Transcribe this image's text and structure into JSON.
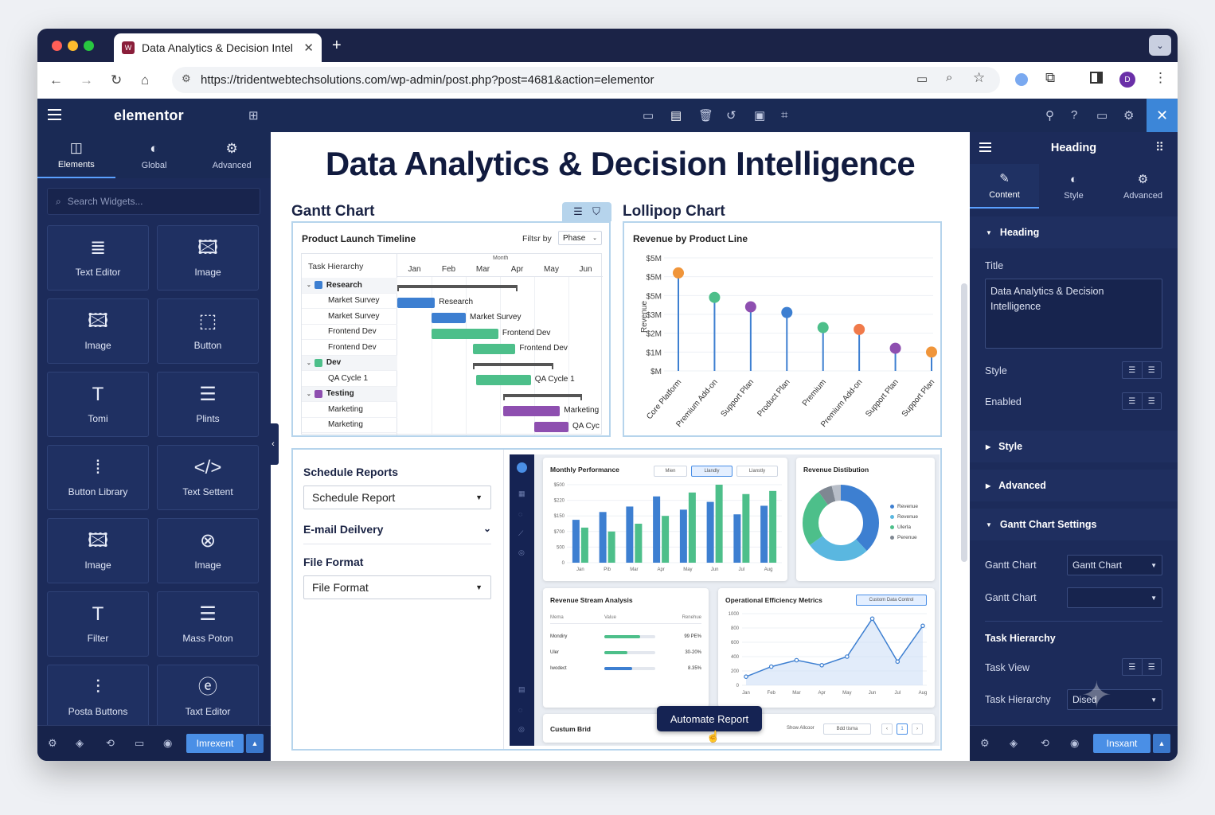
{
  "browser": {
    "tab_title": "Data Analytics & Decision Intel",
    "url": "https://tridentwebtechsolutions.com/wp-admin/post.php?post=4681&action=elementor",
    "profile_initial": "D"
  },
  "app": {
    "brand": "elementor"
  },
  "left_panel": {
    "tabs": [
      "Elements",
      "Global",
      "Advanced"
    ],
    "search_placeholder": "Search Widgets...",
    "widgets": [
      {
        "label": "Text Editor",
        "icon": "≣"
      },
      {
        "label": "Image",
        "icon": "🖾"
      },
      {
        "label": "Image",
        "icon": "🖾"
      },
      {
        "label": "Button",
        "icon": "⬚"
      },
      {
        "label": "Tomi",
        "icon": "T"
      },
      {
        "label": "Plints",
        "icon": "☰"
      },
      {
        "label": "Button Library",
        "icon": "⁞"
      },
      {
        "label": "Text Settent",
        "icon": "</>"
      },
      {
        "label": "Image",
        "icon": "🖾"
      },
      {
        "label": "Image",
        "icon": "⊗"
      },
      {
        "label": "Filter",
        "icon": "T"
      },
      {
        "label": "Mass Poton",
        "icon": "☰"
      },
      {
        "label": "Posta Buttons",
        "icon": "⫶"
      },
      {
        "label": "Taxt Editor",
        "icon": "ⓔ"
      }
    ],
    "footer_button": "Imrexent"
  },
  "page": {
    "title": "Data Analytics & Decision Intelligence",
    "gantt": {
      "section_title": "Gantt Chart",
      "card_title": "Product Launch Timeline",
      "filter_label": "Filtsr by",
      "filter_value": "Phase",
      "month_label": "Month",
      "hierarchy_header": "Task Hierarchy",
      "months": [
        "Jan",
        "Feb",
        "Mar",
        "Apr",
        "May",
        "Jun"
      ],
      "rows": [
        {
          "label": "Research",
          "group": true,
          "color": "#3d7fd1"
        },
        {
          "label": "Market Survey",
          "group": false
        },
        {
          "label": "Market Survey",
          "group": false
        },
        {
          "label": "Frontend Dev",
          "group": false
        },
        {
          "label": "Frontend Dev",
          "group": false
        },
        {
          "label": "Dev",
          "group": true,
          "color": "#4dbf8a"
        },
        {
          "label": "QA Cycle 1",
          "group": false
        },
        {
          "label": "Testing",
          "group": true,
          "color": "#8e4fb0"
        },
        {
          "label": "Marketing",
          "group": false
        },
        {
          "label": "Marketing",
          "group": false
        }
      ],
      "bars": [
        {
          "row": 0,
          "start": 0,
          "end": 3.5,
          "kind": "summary",
          "label": ""
        },
        {
          "row": 1,
          "start": 0,
          "end": 1.1,
          "kind": "blue",
          "label": "Research"
        },
        {
          "row": 2,
          "start": 1,
          "end": 2,
          "kind": "blue",
          "label": "Market Survey"
        },
        {
          "row": 3,
          "start": 1,
          "end": 2.95,
          "kind": "green",
          "label": "Frontend Dev"
        },
        {
          "row": 4,
          "start": 2.2,
          "end": 3.45,
          "kind": "green",
          "label": "Frontend Dev"
        },
        {
          "row": 5,
          "start": 2.2,
          "end": 4.55,
          "kind": "summary",
          "label": ""
        },
        {
          "row": 6,
          "start": 2.3,
          "end": 3.9,
          "kind": "green",
          "label": "QA Cycle 1"
        },
        {
          "row": 7,
          "start": 3.1,
          "end": 5.4,
          "kind": "summary",
          "label": ""
        },
        {
          "row": 8,
          "start": 3.1,
          "end": 4.75,
          "kind": "purple",
          "label": "Marketing"
        },
        {
          "row": 9,
          "start": 4,
          "end": 5,
          "kind": "purple",
          "label": "QA Cyc"
        }
      ]
    },
    "lollipop": {
      "section_title": "Lollipop Chart",
      "card_title": "Revenue by Product Line",
      "ylabel": "Revenue",
      "yticks": [
        "$5M",
        "$5M",
        "$5M",
        "$3M",
        "$2M",
        "$1M",
        "$M"
      ],
      "categories": [
        "Core Platform",
        "Premium Add-on",
        "Support Plan",
        "Product Plan",
        "Premium",
        "Premium Add-on",
        "Support Plan",
        "Support Plan"
      ],
      "values": [
        5.2,
        3.9,
        3.4,
        3.1,
        2.3,
        2.2,
        1.2,
        1.0
      ],
      "colors": [
        "#f0953a",
        "#4dbf8a",
        "#8e4fb0",
        "#3d7fd1",
        "#4dbf8a",
        "#f07a4a",
        "#8e4fb0",
        "#f0953a"
      ]
    },
    "schedule": {
      "title": "Schedule Reports",
      "select_value": "Schedule Report",
      "email_label": "E-mail Deilvery",
      "format_label": "File Format",
      "format_value": "File Format"
    },
    "dashboard": {
      "monthly": {
        "title": "Monthly Performance",
        "chips": [
          "Mien",
          "Llandly",
          "Llanstly"
        ],
        "yticks": [
          "$500",
          "$220",
          "$150",
          "$700",
          "500",
          "0"
        ],
        "months": [
          "Jan",
          "Pib",
          "Mar",
          "Apr",
          "May",
          "Jun",
          "Jul",
          "Aug"
        ],
        "series": [
          {
            "color": "#3d7fd1",
            "values": [
              0.55,
              0.65,
              0.72,
              0.85,
              0.68,
              0.78,
              0.62,
              0.73
            ]
          },
          {
            "color": "#4dbf8a",
            "values": [
              0.45,
              0.4,
              0.5,
              0.6,
              0.9,
              1.0,
              0.88,
              0.92
            ]
          }
        ]
      },
      "distribution": {
        "title": "Revenue Distibution",
        "legend": [
          "Revenue",
          "Revenue",
          "Ulerla",
          "Perenue"
        ],
        "slices": [
          {
            "value": 38,
            "color": "#3d7fd1"
          },
          {
            "value": 27,
            "color": "#5ab7e0"
          },
          {
            "value": 25,
            "color": "#4dbf8a"
          },
          {
            "value": 6,
            "color": "#7f8792"
          },
          {
            "value": 4,
            "color": "#b8bec8"
          }
        ]
      },
      "stream": {
        "title": "Revenue Stream Analysis",
        "columns": [
          "Mema",
          "Value",
          "Renehue"
        ],
        "rows": [
          {
            "name": "Mondiry",
            "pct": "99 PE%",
            "fill": 0.7,
            "color": "#4dbf8a"
          },
          {
            "name": "Uler",
            "pct": "30-20%",
            "fill": 0.45,
            "color": "#4dbf8a"
          },
          {
            "name": "Iwodect",
            "pct": "8.35%",
            "fill": 0.55,
            "color": "#3d7fd1"
          }
        ]
      },
      "efficiency": {
        "title": "Operational Efficiency Metrics",
        "chip": "Custom Data Control",
        "yticks": [
          "1000",
          "800",
          "600",
          "400",
          "200",
          "0"
        ],
        "months": [
          "Jan",
          "Feb",
          "Mar",
          "Apr",
          "May",
          "Jun",
          "Jul",
          "Aug"
        ],
        "values": [
          120,
          260,
          350,
          280,
          400,
          930,
          330,
          830
        ]
      },
      "custom_grid": {
        "title": "Custum Brid",
        "show_label": "Show Allcoor",
        "select": "Bdd tisma",
        "page": "1"
      },
      "automate_button": "Automate Report"
    }
  },
  "right_panel": {
    "title": "Heading",
    "tabs": [
      "Content",
      "Style",
      "Advanced"
    ],
    "heading_section": "Heading",
    "title_label": "Title",
    "title_value": "Data Analytics & Decision Intelligence",
    "style_label": "Style",
    "enabled_label": "Enabled",
    "style_section": "Style",
    "advanced_section": "Advanced",
    "gantt_section": "Gantt Chart Settings",
    "gantt_label_1": "Gantt Chart",
    "gantt_value_1": "Gantt Chart",
    "gantt_label_2": "Gantt Chart",
    "task_hierarchy_head": "Task Hierarchy",
    "task_view_label": "Task View",
    "task_hierarchy_label": "Task Hierarchy",
    "task_hierarchy_value": "Dised",
    "footer_button": "Insxant"
  }
}
